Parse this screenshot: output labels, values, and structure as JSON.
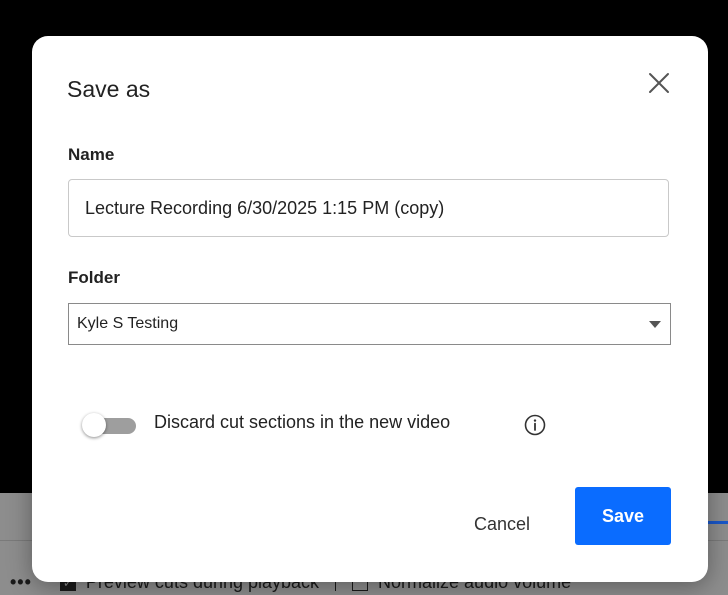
{
  "dialog": {
    "title": "Save as",
    "name_label": "Name",
    "name_value": "Lecture Recording 6/30/2025 1:15 PM (copy)",
    "folder_label": "Folder",
    "folder_value": "Kyle S Testing",
    "discard_toggle": {
      "label": "Discard cut sections in the new video",
      "on": false
    },
    "cancel_label": "Cancel",
    "save_label": "Save",
    "accent_color": "#0a6cff"
  },
  "background": {
    "dots": "•••",
    "preview_cuts_label": "Preview cuts during playback",
    "preview_cuts_checked": true,
    "normalize_audio_label": "Normalize audio volume",
    "normalize_audio_checked": false
  },
  "icons": [
    "close-icon",
    "info-icon",
    "chevron-down-icon",
    "checkmark-icon",
    "more-icon"
  ]
}
